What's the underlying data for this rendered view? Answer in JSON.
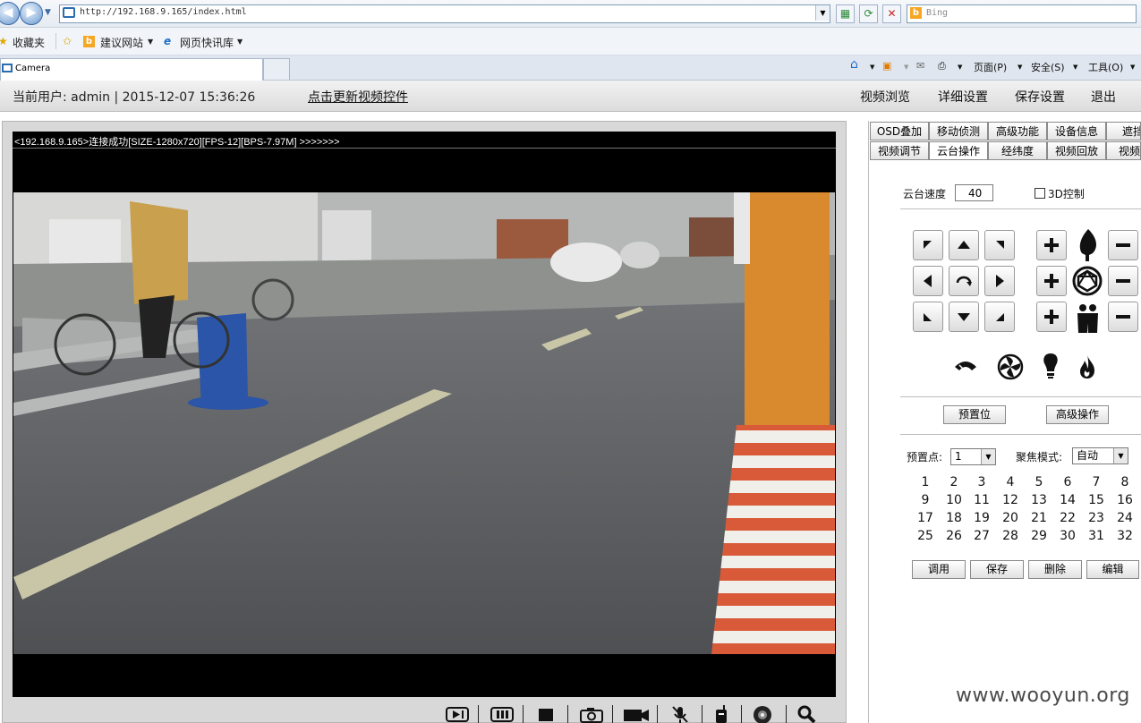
{
  "browser": {
    "url": "http://192.168.9.165/index.html",
    "search_placeholder": "Bing",
    "favorites_label": "收藏夹",
    "suggested_sites": "建议网站",
    "web_slice_gallery": "网页快讯库",
    "tab_title": "Camera",
    "cmd_page": "页面(P)",
    "cmd_safety": "安全(S)",
    "cmd_tools": "工具(O)"
  },
  "header": {
    "current_user": "当前用户: admin | 2015-12-07 15:36:26",
    "update_link": "点击更新视频控件",
    "nav": [
      "视频浏览",
      "详细设置",
      "保存设置",
      "退出"
    ]
  },
  "video": {
    "osd_text": "<192.168.9.165>连接成功[SIZE-1280x720][FPS-12][BPS-7.97M] >>>>>>>"
  },
  "tabs": {
    "row1": [
      "OSD叠加",
      "移动侦测",
      "高级功能",
      "设备信息",
      "遮挡"
    ],
    "row2": [
      "视频调节",
      "云台操作",
      "经纬度",
      "视频回放",
      "视频"
    ]
  },
  "ptz": {
    "speed_label": "云台速度",
    "speed_value": "40",
    "control_3d_label": "3D控制",
    "preset_button": "预置位",
    "advanced_button": "高级操作",
    "preset_point_label": "预置点:",
    "preset_point_value": "1",
    "focus_mode_label": "聚焦模式:",
    "focus_mode_value": "自动",
    "presets": [
      "1",
      "2",
      "3",
      "4",
      "5",
      "6",
      "7",
      "8",
      "9",
      "10",
      "11",
      "12",
      "13",
      "14",
      "15",
      "16",
      "17",
      "18",
      "19",
      "20",
      "21",
      "22",
      "23",
      "24",
      "25",
      "26",
      "27",
      "28",
      "29",
      "30",
      "31",
      "32"
    ],
    "call_button": "调用",
    "save_button": "保存",
    "delete_button": "删除",
    "edit_button": "编辑"
  },
  "watermark": "www.wooyun.org"
}
